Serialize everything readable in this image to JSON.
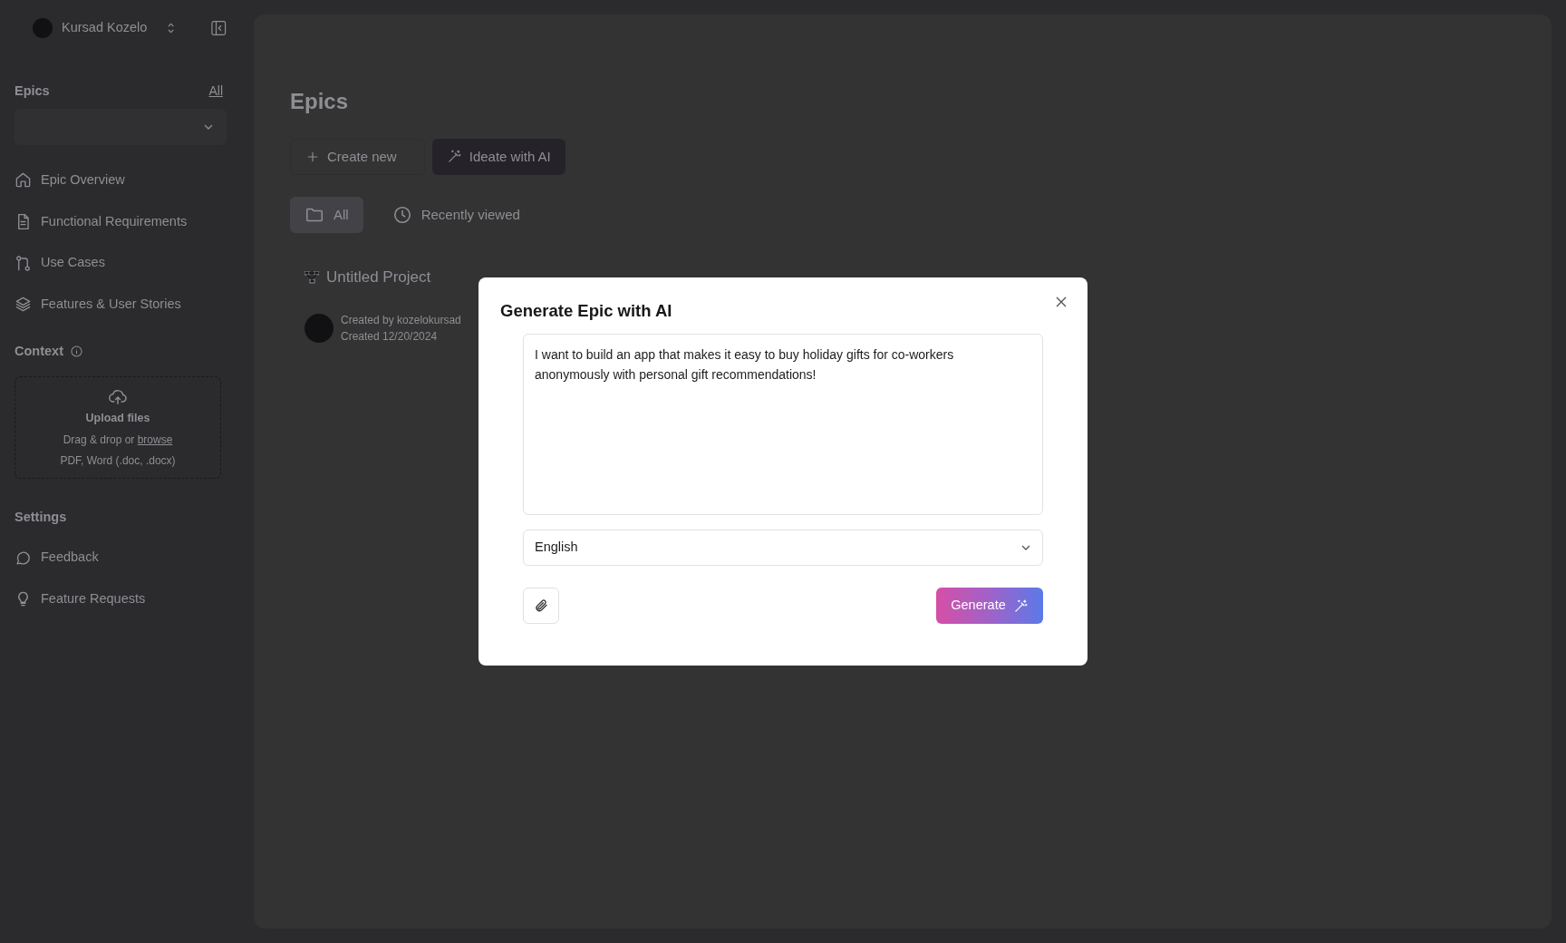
{
  "user": {
    "name": "Kursad Kozelo"
  },
  "sidebar": {
    "epics": {
      "label": "Epics",
      "all_link": "All"
    },
    "nav": [
      {
        "label": "Epic Overview"
      },
      {
        "label": "Functional Requirements"
      },
      {
        "label": "Use Cases"
      },
      {
        "label": "Features & User Stories"
      }
    ],
    "context": {
      "label": "Context",
      "upload_title": "Upload files",
      "hint": "Drag & drop or",
      "browse_link": "browse",
      "formats": "PDF, Word (.doc, .docx)"
    },
    "settings": {
      "label": "Settings",
      "items": [
        {
          "label": "Feedback"
        },
        {
          "label": "Feature Requests"
        }
      ]
    }
  },
  "main": {
    "title": "Epics",
    "buttons": [
      {
        "label": "Create new",
        "kind": "outline"
      },
      {
        "label": "Ideate with AI",
        "kind": "ai"
      }
    ],
    "tabs": [
      {
        "label": "All",
        "selected": true
      },
      {
        "label": "Recently viewed",
        "selected": false
      }
    ],
    "projects": [
      {
        "name": "Untitled Project",
        "created_by": "Created by kozelokursad",
        "created": "Created 12/20/2024"
      }
    ]
  },
  "modal": {
    "title": "Generate Epic with AI",
    "prompt": "I want to build an app that makes it easy to buy holiday gifts for co-workers anonymously with personal gift recommendations!",
    "language": "English",
    "generate_button": "Generate"
  }
}
